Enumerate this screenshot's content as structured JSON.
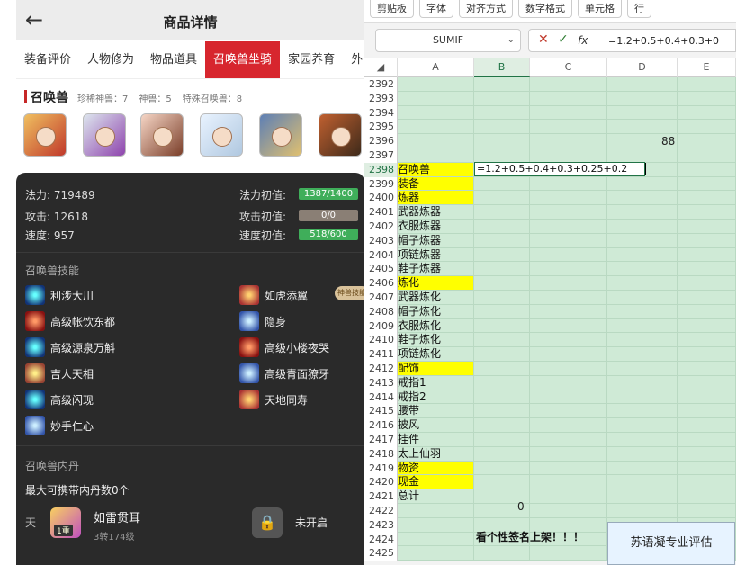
{
  "mobile": {
    "header": {
      "title": "商品详情"
    },
    "tabs": [
      "装备评价",
      "人物修为",
      "物品道具",
      "召唤兽坐骑",
      "家园养育",
      "外"
    ],
    "pet_section": {
      "label": "召唤兽",
      "counts": [
        "珍稀神兽：7",
        "神兽：5",
        "特殊召唤兽：8"
      ]
    },
    "stats": [
      {
        "label": "法力: 719489",
        "init_label": "法力初值:",
        "bar": "1387/1400",
        "bar_color": "green"
      },
      {
        "label": "攻击: 12618",
        "init_label": "攻击初值:",
        "bar": "0/0",
        "bar_color": "gray"
      },
      {
        "label": "速度: 957",
        "init_label": "速度初值:",
        "bar": "518/600",
        "bar_color": "green"
      }
    ],
    "skills_title": "召唤兽技能",
    "skills": [
      {
        "name": "利涉大川",
        "icon": "water-skill-icon"
      },
      {
        "name": "如虎添翼",
        "icon": "tiger-skill-icon"
      },
      {
        "name": "高级帐饮东都",
        "icon": "fire-skill-icon"
      },
      {
        "name": "隐身",
        "icon": "stealth-skill-icon"
      },
      {
        "name": "高级源泉万斛",
        "icon": "spring-skill-icon"
      },
      {
        "name": "高级小楼夜哭",
        "icon": "night-skill-icon"
      },
      {
        "name": "吉人天相",
        "icon": "luck-skill-icon"
      },
      {
        "name": "高级青面獠牙",
        "icon": "fang-skill-icon"
      },
      {
        "name": "高级闪现",
        "icon": "flash-skill-icon"
      },
      {
        "name": "天地同寿",
        "icon": "longevity-skill-icon"
      },
      {
        "name": "妙手仁心",
        "icon": "heal-skill-icon"
      }
    ],
    "seal_text": "神兽技能",
    "inner_title": "召唤兽内丹",
    "inner_capacity": "最大可携带内丹数0个",
    "inner_prefix": "天",
    "inner_item": {
      "name": "如雷贯耳",
      "level": "3转174级",
      "badge": "1重"
    },
    "locked_label": "未开启"
  },
  "excel": {
    "ribbon": [
      "剪贴板",
      "字体",
      "对齐方式",
      "数字格式",
      "单元格",
      "行"
    ],
    "name_box": "SUMIF",
    "formula_text": "=1.2+0.5+0.4+0.3+0",
    "columns": [
      "A",
      "B",
      "C",
      "D",
      "E"
    ],
    "edit_cell": "=1.2+0.5+0.4+0.3+0.25+0.2",
    "d2396": "88",
    "b2421": "0",
    "eval_label": "苏语凝专业评估",
    "note_2423": "看个性签名上架！！！",
    "rows": [
      {
        "n": "2392",
        "a": ""
      },
      {
        "n": "2393",
        "a": ""
      },
      {
        "n": "2394",
        "a": ""
      },
      {
        "n": "2395",
        "a": ""
      },
      {
        "n": "2396",
        "a": ""
      },
      {
        "n": "2397",
        "a": ""
      },
      {
        "n": "2398",
        "a": "召唤兽",
        "y": true
      },
      {
        "n": "2399",
        "a": "装备",
        "y": true
      },
      {
        "n": "2400",
        "a": "炼器",
        "y": true
      },
      {
        "n": "2401",
        "a": "武器炼器"
      },
      {
        "n": "2402",
        "a": "衣服炼器"
      },
      {
        "n": "2403",
        "a": "帽子炼器"
      },
      {
        "n": "2404",
        "a": "项链炼器"
      },
      {
        "n": "2405",
        "a": "鞋子炼器"
      },
      {
        "n": "2406",
        "a": "炼化",
        "y": true
      },
      {
        "n": "2407",
        "a": "武器炼化"
      },
      {
        "n": "2408",
        "a": "帽子炼化"
      },
      {
        "n": "2409",
        "a": "衣服炼化"
      },
      {
        "n": "2410",
        "a": "鞋子炼化"
      },
      {
        "n": "2411",
        "a": "项链炼化"
      },
      {
        "n": "2412",
        "a": "配饰",
        "y": true
      },
      {
        "n": "2413",
        "a": "戒指1"
      },
      {
        "n": "2414",
        "a": "戒指2"
      },
      {
        "n": "2415",
        "a": "腰带"
      },
      {
        "n": "2416",
        "a": "披风"
      },
      {
        "n": "2417",
        "a": "挂件"
      },
      {
        "n": "2418",
        "a": "太上仙羽"
      },
      {
        "n": "2419",
        "a": "物资",
        "y": true
      },
      {
        "n": "2420",
        "a": "现金",
        "y": true
      },
      {
        "n": "2421",
        "a": "总计"
      },
      {
        "n": "2422",
        "a": ""
      },
      {
        "n": "2423",
        "a": ""
      },
      {
        "n": "2424",
        "a": ""
      },
      {
        "n": "2425",
        "a": ""
      }
    ]
  }
}
